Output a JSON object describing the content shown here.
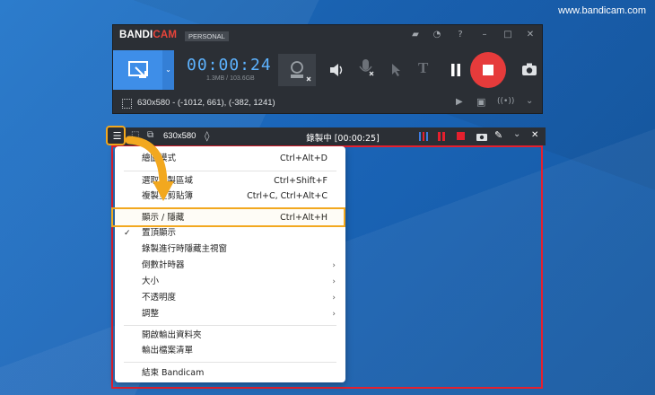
{
  "watermark": "www.bandicam.com",
  "app": {
    "logo_a": "BANDI",
    "logo_b": "CAM",
    "edition": "PERSONAL",
    "timer": "00:00:24",
    "size": "1.3MB / 103.6GB",
    "region_info": "630x580 - (-1012, 661), (-382, 1241)"
  },
  "recbar": {
    "size": "630x580",
    "status": "錄製中 [00:00:25]"
  },
  "menu": {
    "items": [
      {
        "label": "繪圖模式",
        "shortcut": "Ctrl+Alt+D"
      },
      {
        "label": "選取錄製區域",
        "shortcut": "Ctrl+Shift+F"
      },
      {
        "label": "複製至剪貼簿",
        "shortcut": "Ctrl+C, Ctrl+Alt+C"
      },
      {
        "label": "顯示 / 隱藏",
        "shortcut": "Ctrl+Alt+H"
      },
      {
        "label": "置頂顯示",
        "checked": "✓"
      },
      {
        "label": "錄製進行時隱藏主視窗"
      },
      {
        "label": "倒數計時器",
        "arrow": "›"
      },
      {
        "label": "大小",
        "arrow": "›"
      },
      {
        "label": "不透明度",
        "arrow": "›"
      },
      {
        "label": "調整",
        "arrow": "›"
      },
      {
        "label": "開啟輸出資料夾"
      },
      {
        "label": "輸出檔案清單"
      },
      {
        "label": "結束 Bandicam"
      }
    ]
  },
  "colors": {
    "accent_blue": "#3e8ee8",
    "record_red": "#e63b3b",
    "highlight_orange": "#f2a81f",
    "frame_red": "#e5202e"
  }
}
